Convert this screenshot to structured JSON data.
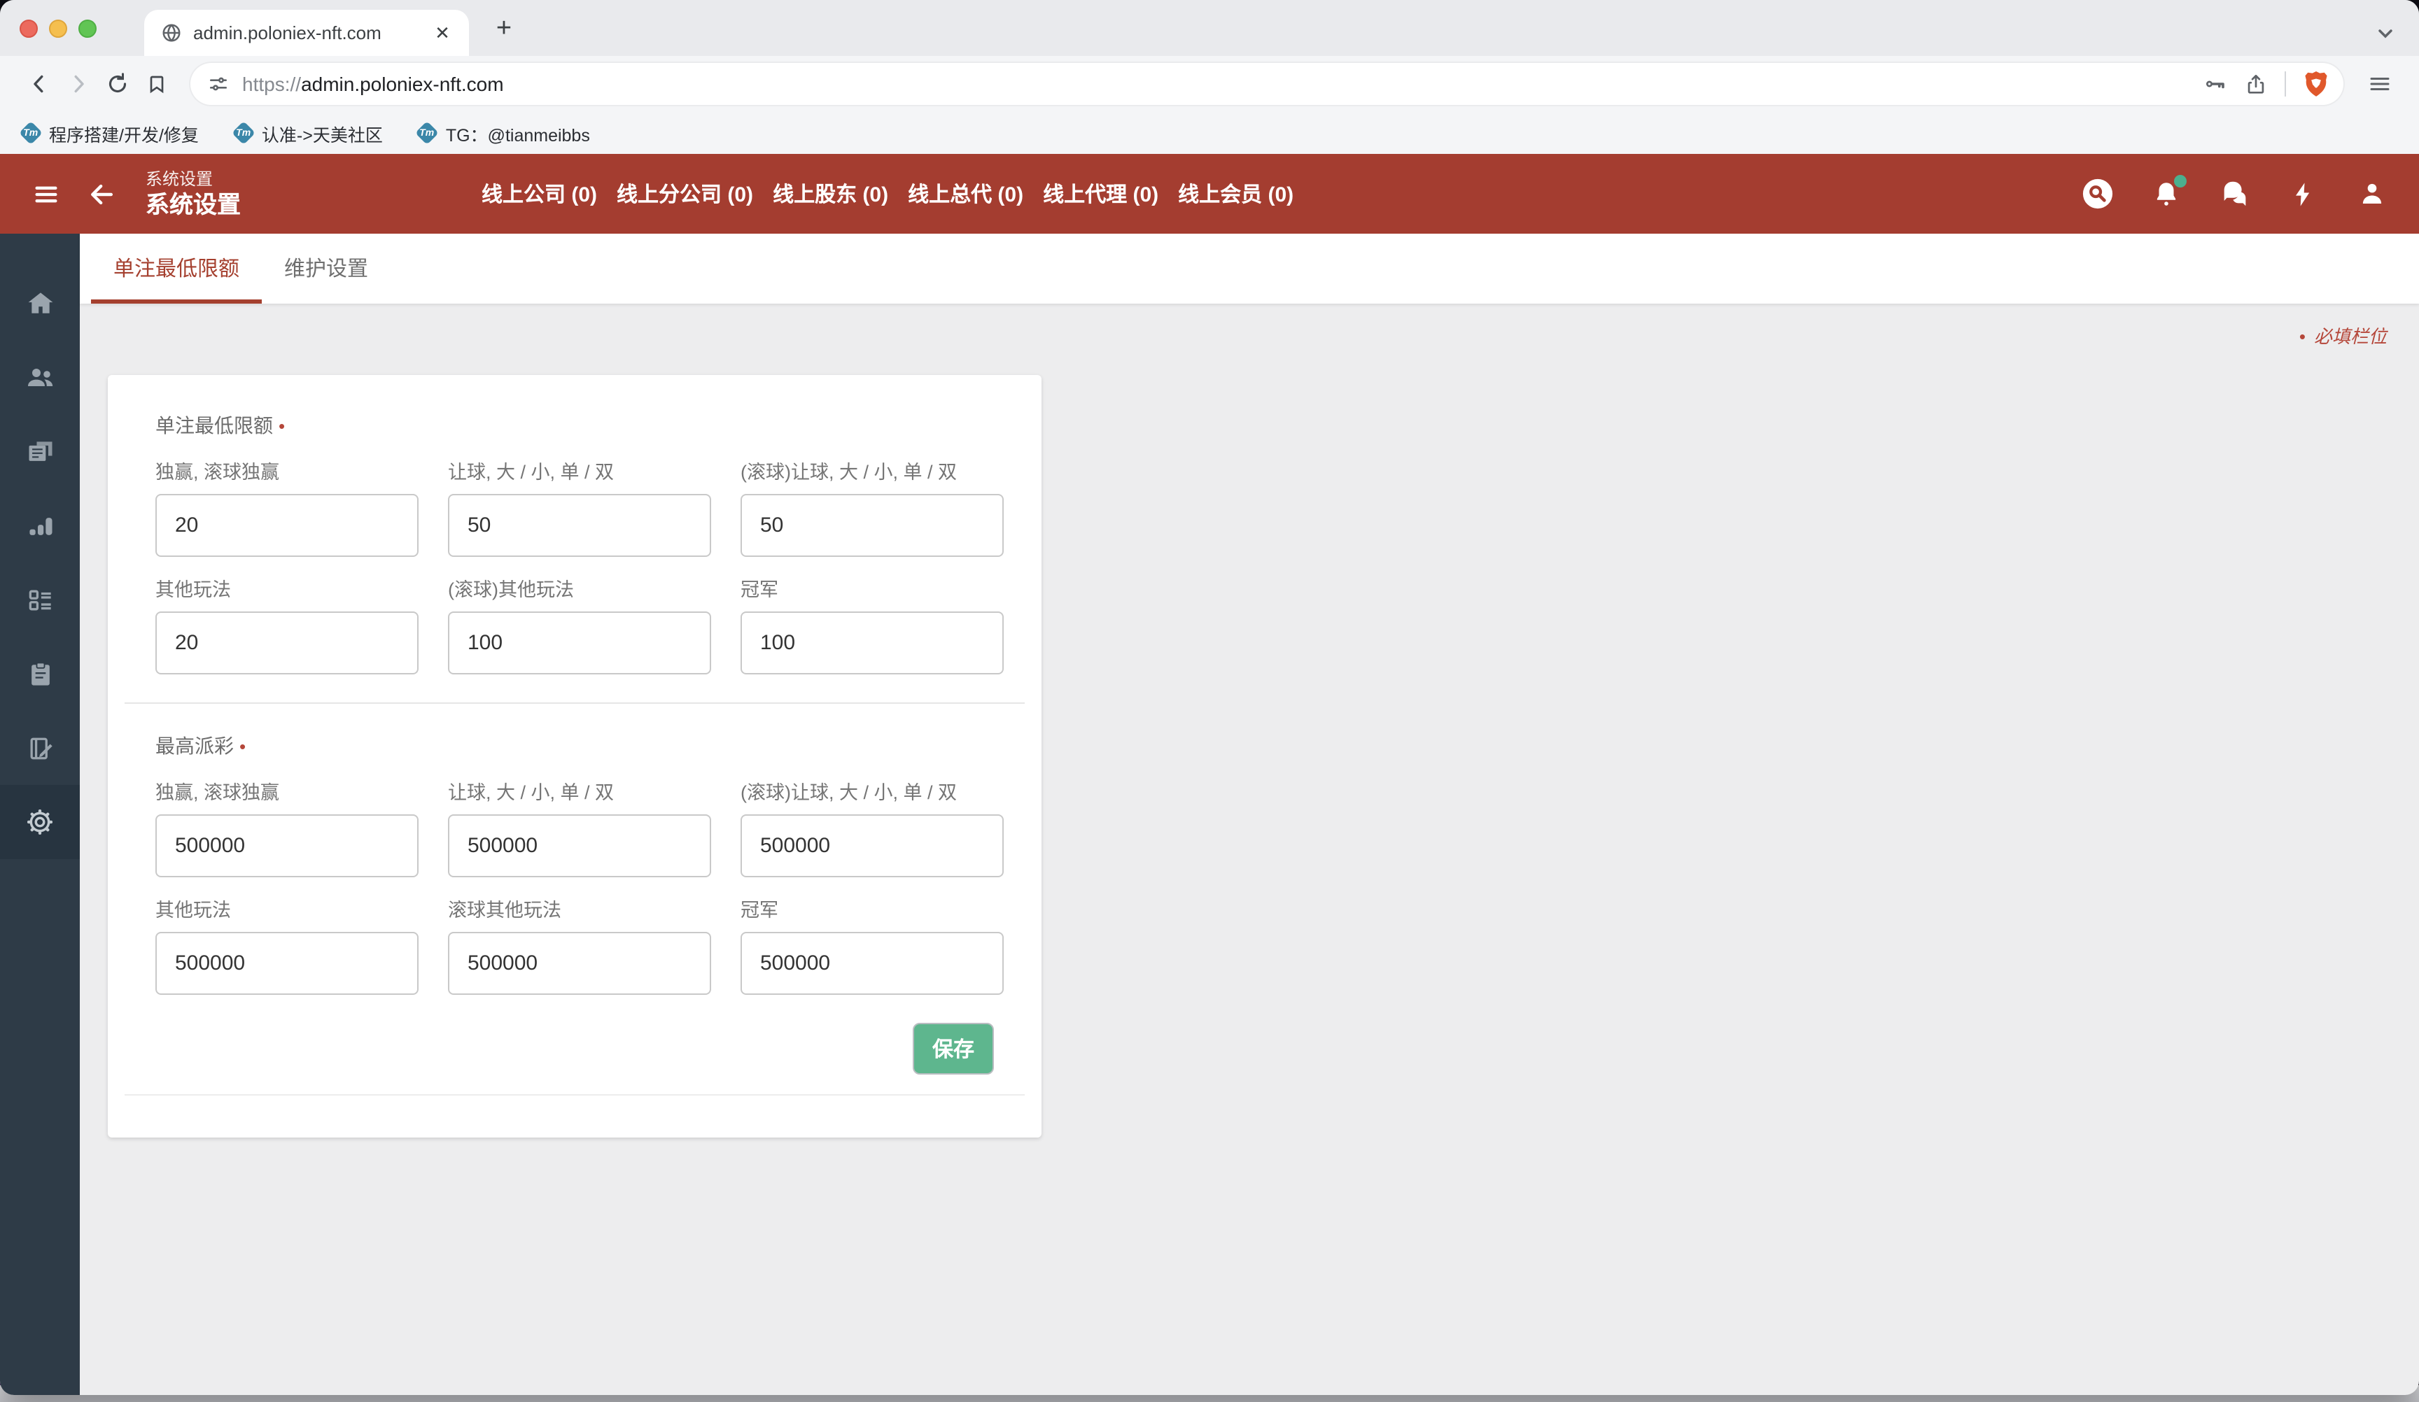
{
  "browser": {
    "tab_title": "admin.poloniex-nft.com",
    "url_scheme": "https://",
    "url_host": "admin.poloniex-nft.com",
    "new_tab_label": "+",
    "close_tab_label": "✕",
    "favicon_text": "Tm",
    "bookmarks": [
      {
        "label": "程序搭建/开发/修复"
      },
      {
        "label": "认准->天美社区"
      },
      {
        "label": "TG：@tianmeibbs"
      }
    ]
  },
  "header": {
    "breadcrumb": "系统设置",
    "title": "系统设置",
    "nav": [
      {
        "label": "线上公司 (0)"
      },
      {
        "label": "线上分公司 (0)"
      },
      {
        "label": "线上股东 (0)"
      },
      {
        "label": "线上总代 (0)"
      },
      {
        "label": "线上代理 (0)"
      },
      {
        "label": "线上会员 (0)"
      }
    ]
  },
  "page_tabs": [
    {
      "label": "单注最低限额",
      "active": true
    },
    {
      "label": "维护设置",
      "active": false
    }
  ],
  "required_marker": "•",
  "required_note": "必填栏位",
  "form": {
    "sections": [
      {
        "title": "单注最低限额",
        "fields": [
          {
            "label": "独赢, 滚球独赢",
            "value": "20"
          },
          {
            "label": "让球, 大 / 小, 单 / 双",
            "value": "50"
          },
          {
            "label": "(滚球)让球, 大 / 小, 单 / 双",
            "value": "50"
          },
          {
            "label": "其他玩法",
            "value": "20"
          },
          {
            "label": "(滚球)其他玩法",
            "value": "100"
          },
          {
            "label": "冠军",
            "value": "100"
          }
        ]
      },
      {
        "title": "最高派彩",
        "fields": [
          {
            "label": "独赢, 滚球独赢",
            "value": "500000"
          },
          {
            "label": "让球, 大 / 小, 单 / 双",
            "value": "500000"
          },
          {
            "label": "(滚球)让球, 大 / 小, 单 / 双",
            "value": "500000"
          },
          {
            "label": "其他玩法",
            "value": "500000"
          },
          {
            "label": "滚球其他玩法",
            "value": "500000"
          },
          {
            "label": "冠军",
            "value": "500000"
          }
        ]
      }
    ],
    "save_label": "保存"
  },
  "colors": {
    "header_red": "#A43D30",
    "sidebar_dark": "#2E3B47",
    "sidebar_active": "#273440",
    "tab_active_red": "#A5402F",
    "save_green": "#5EB68E",
    "required_red": "#B5473A",
    "notification_green": "#4CAF8E",
    "favicon_teal": "#3B87A9",
    "brave_orange": "#E0582B"
  },
  "icons": {
    "browser": [
      "globe-icon",
      "close-icon",
      "plus-icon",
      "chevron-down-icon",
      "back-icon",
      "forward-icon",
      "reload-icon",
      "bookmark-icon",
      "site-settings-icon",
      "key-icon",
      "share-icon",
      "brave-icon",
      "menu-icon"
    ],
    "header": [
      "hamburger-icon",
      "arrow-left-icon",
      "search-icon",
      "bell-icon",
      "chat-icon",
      "bolt-icon",
      "user-icon"
    ],
    "sidebar": [
      "home-icon",
      "users-icon",
      "pages-icon",
      "chart-icon",
      "ballot-icon",
      "clipboard-icon",
      "book-edit-icon",
      "gear-icon"
    ]
  }
}
